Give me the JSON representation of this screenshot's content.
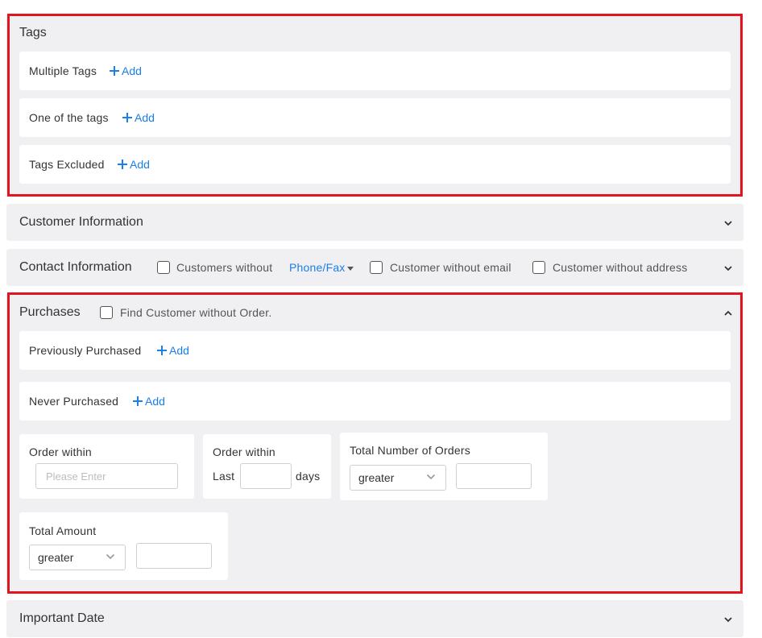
{
  "tags": {
    "title": "Tags",
    "rows": [
      {
        "label": "Multiple Tags",
        "add": "Add"
      },
      {
        "label": "One of the tags",
        "add": "Add"
      },
      {
        "label": "Tags Excluded",
        "add": "Add"
      }
    ]
  },
  "customer_info": {
    "title": "Customer Information"
  },
  "contact_info": {
    "title": "Contact Information",
    "cb_without_prefix": "Customers without",
    "phone_fax": "Phone/Fax",
    "cb_without_email": "Customer without email",
    "cb_without_address": "Customer without address"
  },
  "purchases": {
    "title": "Purchases",
    "find_without_order": "Find Customer without Order.",
    "previously_purchased": {
      "label": "Previously Purchased",
      "add": "Add"
    },
    "never_purchased": {
      "label": "Never Purchased",
      "add": "Add"
    },
    "order_within": {
      "label": "Order within",
      "placeholder": "Please Enter"
    },
    "order_within_last": {
      "label": "Order within",
      "last": "Last",
      "days": "days"
    },
    "total_orders": {
      "label": "Total Number of Orders",
      "select": "greater"
    },
    "total_amount": {
      "label": "Total Amount",
      "select": "greater"
    }
  },
  "important_date": {
    "title": "Important Date"
  },
  "colors": {
    "accent": "#1a7fe8",
    "highlight": "#e3141e",
    "panel": "#f0f0f2"
  }
}
